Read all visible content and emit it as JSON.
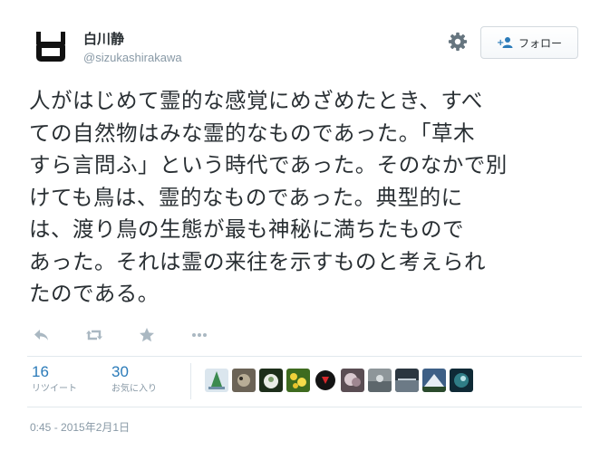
{
  "user": {
    "name": "白川静",
    "handle": "@sizukashirakawa"
  },
  "header": {
    "settings_icon": "gear-icon",
    "follow_icon": "person-add-icon",
    "follow_label": "フォロー"
  },
  "tweet": {
    "lines": [
      "人がはじめて霊的な感覚にめざめたとき、すべ",
      "ての自然物はみな霊的なものであった。「草木",
      "すら言問ふ」という時代であった。そのなかで別",
      "けても鳥は、霊的なものであった。典型的に",
      "は、渡り鳥の生態が最も神秘に満ちたもので",
      "あった。それは霊の来往を示すものと考えられ",
      "たのである。"
    ]
  },
  "actions": {
    "icons": [
      "reply-icon",
      "retweet-icon",
      "favorite-icon",
      "more-icon"
    ]
  },
  "stats": {
    "retweets": {
      "count": "16",
      "label": "リツイート"
    },
    "favorites": {
      "count": "30",
      "label": "お気に入り"
    }
  },
  "favorited_by_count": 10,
  "timestamp": "0:45 - 2015年2月1日",
  "colors": {
    "link_blue": "#2b7bb9",
    "muted": "#8899a6",
    "text": "#292f33",
    "border": "#e1e8ed",
    "icon_gray": "#aab8c2"
  }
}
